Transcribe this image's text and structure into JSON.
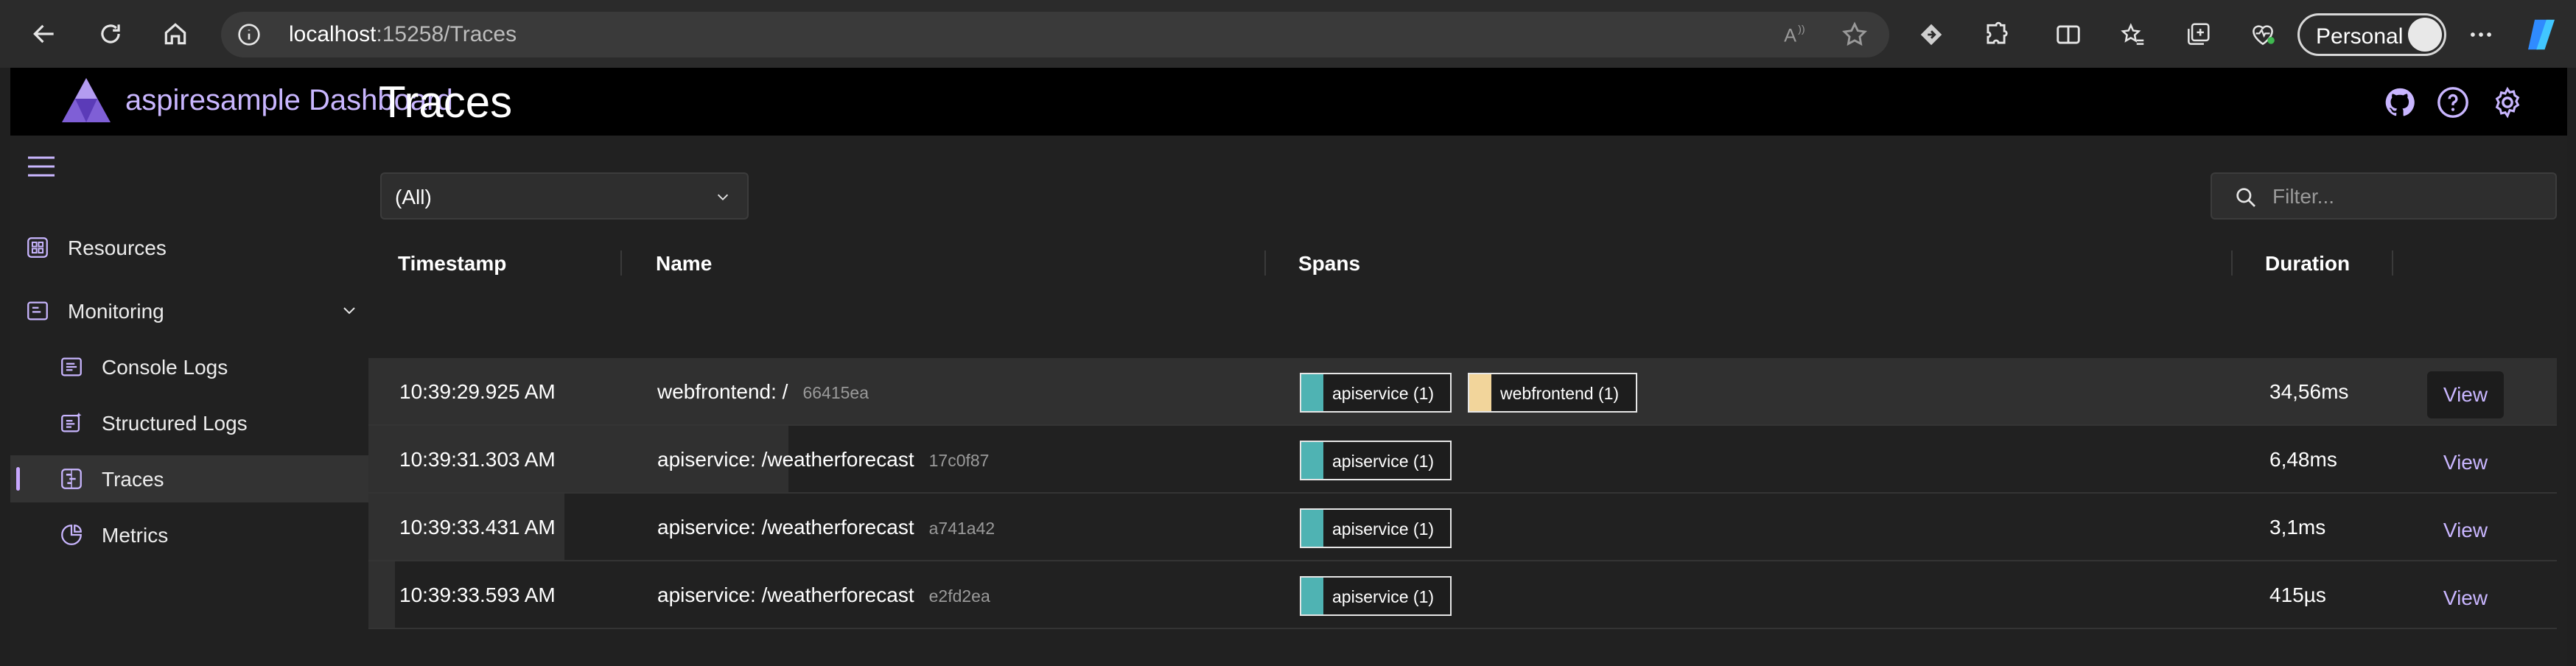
{
  "browser": {
    "url_host": "localhost",
    "url_rest": ":15258/Traces",
    "profile_label": "Personal"
  },
  "header": {
    "title": "aspiresample Dashboard"
  },
  "sidebar": {
    "items": [
      {
        "label": "Resources"
      },
      {
        "label": "Monitoring"
      },
      {
        "label": "Console Logs"
      },
      {
        "label": "Structured Logs"
      },
      {
        "label": "Traces"
      },
      {
        "label": "Metrics"
      }
    ]
  },
  "main": {
    "title": "Traces",
    "select_value": "(All)",
    "filter_placeholder": "Filter...",
    "columns": [
      "Timestamp",
      "Name",
      "Spans",
      "Duration"
    ],
    "rows": [
      {
        "timestamp": "10:39:29.925 AM",
        "name": "webfrontend: /",
        "trace_id": "66415ea",
        "spans": [
          {
            "label": "apiservice (1)",
            "color": "#4fb3b3"
          },
          {
            "label": "webfrontend (1)",
            "color": "#f2d59b"
          }
        ],
        "duration": "34,56ms",
        "action": "View"
      },
      {
        "timestamp": "10:39:31.303 AM",
        "name": "apiservice: /weatherforecast",
        "trace_id": "17c0f87",
        "spans": [
          {
            "label": "apiservice (1)",
            "color": "#4fb3b3"
          }
        ],
        "duration": "6,48ms",
        "action": "View"
      },
      {
        "timestamp": "10:39:33.431 AM",
        "name": "apiservice: /weatherforecast",
        "trace_id": "a741a42",
        "spans": [
          {
            "label": "apiservice (1)",
            "color": "#4fb3b3"
          }
        ],
        "duration": "3,1ms",
        "action": "View"
      },
      {
        "timestamp": "10:39:33.593 AM",
        "name": "apiservice: /weatherforecast",
        "trace_id": "e2fd2ea",
        "spans": [
          {
            "label": "apiservice (1)",
            "color": "#4fb3b3"
          }
        ],
        "duration": "415µs",
        "action": "View"
      }
    ]
  },
  "colors": {
    "accent": "#c9b6ff",
    "apiservice": "#4fb3b3",
    "webfrontend": "#f2d59b"
  }
}
